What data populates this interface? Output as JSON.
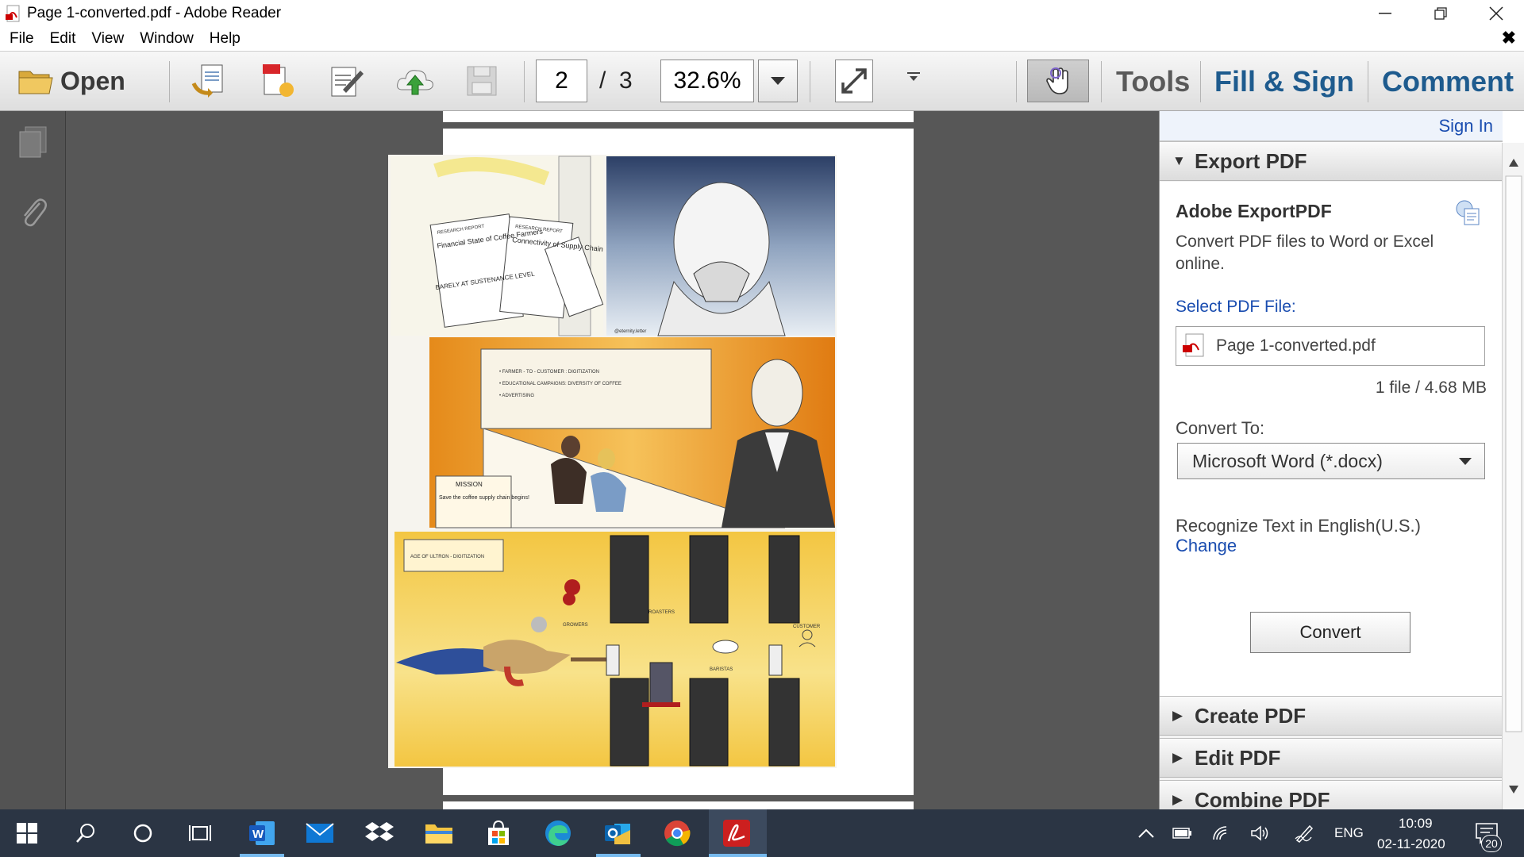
{
  "window": {
    "title": "Page 1-converted.pdf - Adobe Reader"
  },
  "menu": {
    "items": [
      "File",
      "Edit",
      "View",
      "Window",
      "Help"
    ]
  },
  "toolbar": {
    "open_label": "Open",
    "page_current": "2",
    "page_sep": "/",
    "page_total": "3",
    "zoom": "32.6%",
    "tools_label": "Tools",
    "fill_sign_label": "Fill & Sign",
    "comment_label": "Comment"
  },
  "artwork": {
    "panel1_doc1": "RESEARCH REPORT",
    "panel1_doc1_title": "Financial State of Coffee Farmers",
    "panel1_doc1_note": "BARELY AT SUSTENANCE LEVEL",
    "panel1_doc2": "RESEARCH REPORT",
    "panel1_doc2_title": "Connectivity of Supply Chain",
    "panel1_sig": "@eternity.letter",
    "panel2_bullet1": "• FARMER - TO - CUSTOMER : DIGITIZATION",
    "panel2_bullet2": "• EDUCATIONAL CAMPAIGNS: DIVERSITY OF COFFEE",
    "panel2_bullet3": "• ADVERTISING",
    "mission_title": "MISSION",
    "mission_text": "Save the coffee supply chain begins!",
    "panel3_box": "AGE OF ULTRON - DIGITIZATION",
    "label_growers": "GROWERS",
    "label_roasters": "ROASTERS",
    "label_baristas": "BARISTAS",
    "label_customer": "CUSTOMER"
  },
  "right_panel": {
    "sign_in": "Sign In",
    "export_header": "Export PDF",
    "export_title": "Adobe ExportPDF",
    "export_desc": "Convert PDF files to Word or Excel online.",
    "select_label": "Select PDF File:",
    "file_name": "Page 1-converted.pdf",
    "file_info": "1 file / 4.68 MB",
    "convert_to_label": "Convert To:",
    "convert_to_value": "Microsoft Word (*.docx)",
    "recognize_text": "Recognize Text in English(U.S.)",
    "change_link": "Change",
    "convert_button": "Convert",
    "create_pdf": "Create PDF",
    "edit_pdf": "Edit PDF",
    "combine_pdf": "Combine PDF"
  },
  "taskbar": {
    "lang": "ENG",
    "time": "10:09",
    "date": "02-11-2020",
    "notifications": "20"
  },
  "colors": {
    "accent_blue": "#1a4db0",
    "taskbar": "#2b3544",
    "canvas": "#575757"
  }
}
